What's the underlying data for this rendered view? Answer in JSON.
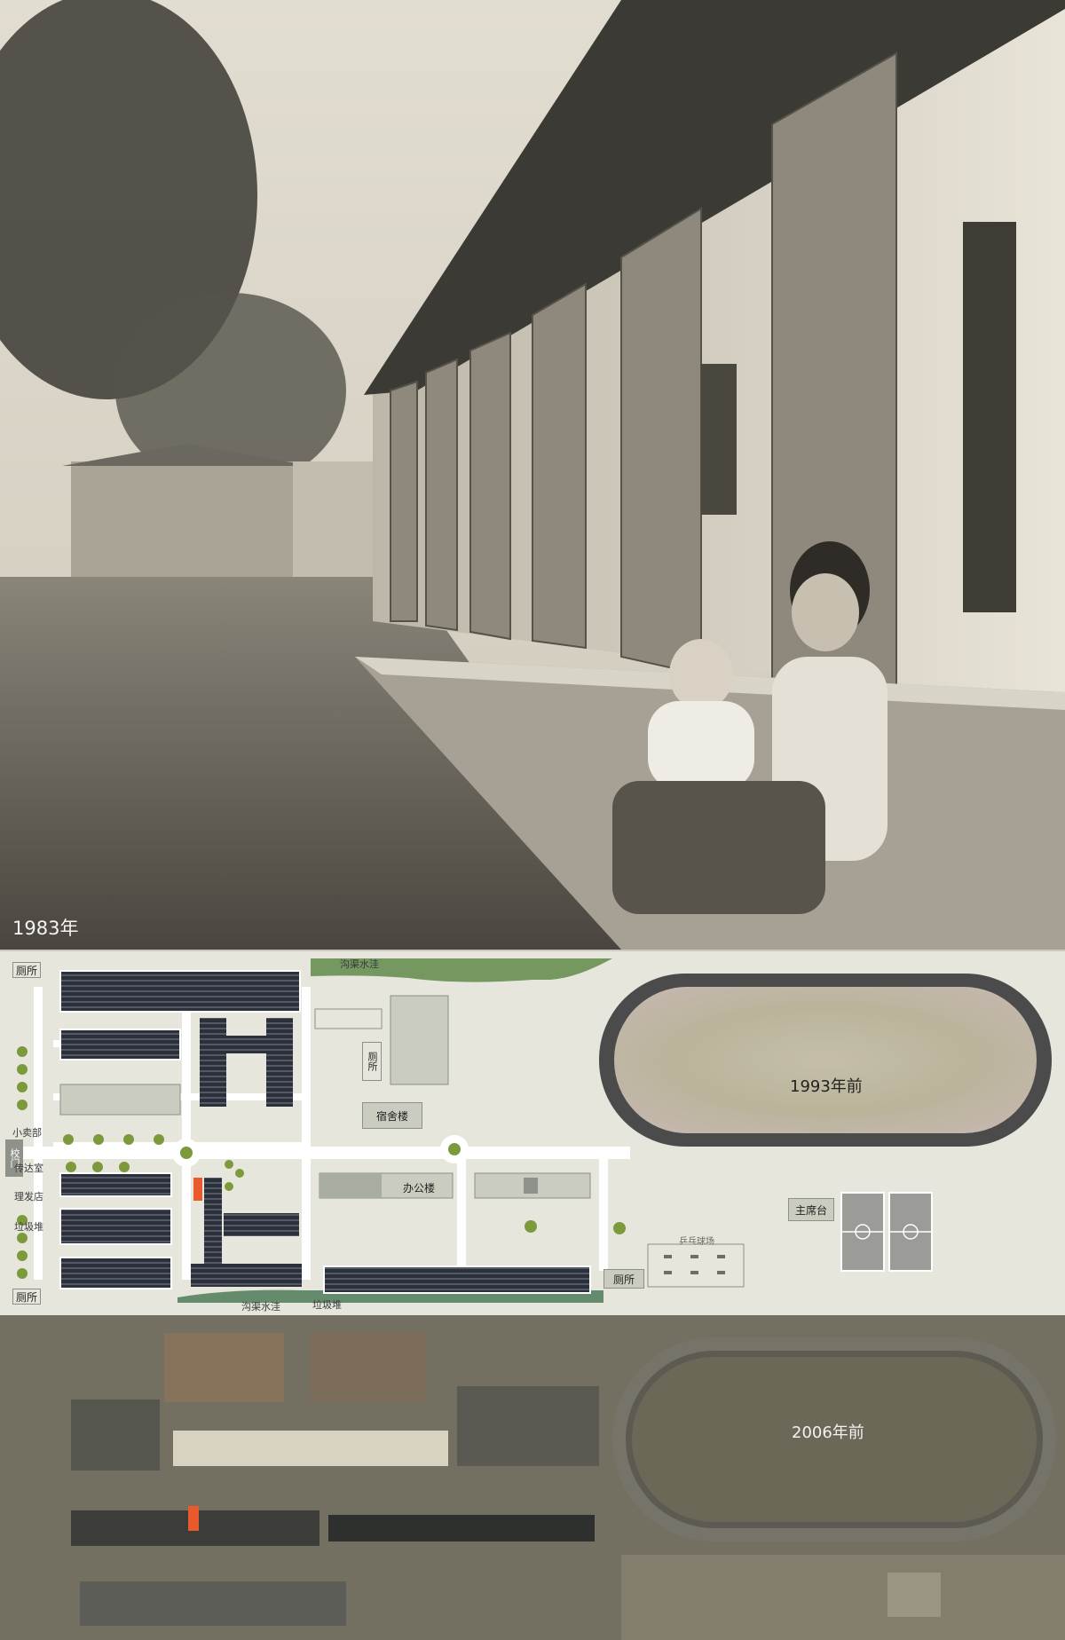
{
  "photo": {
    "year_label": "1983年"
  },
  "plan": {
    "labels": {
      "ditch_top": "沟渠水洼",
      "toilet_topleft": "厕所",
      "toilet_mid": "厕所",
      "dorm": "宿舍楼",
      "shop": "小卖部",
      "gate": "校门",
      "reception": "传达室",
      "barber": "理发店",
      "garbage_left": "垃圾堆",
      "toilet_bottomleft": "厕所",
      "office": "办公楼",
      "podium": "主席台",
      "pingpong": "乒乓球场",
      "toilet_right": "厕所",
      "ditch_bottom": "沟渠水洼",
      "garbage_bottom": "垃圾堆"
    },
    "year_label": "1993年前"
  },
  "satellite": {
    "year_label": "2006年前"
  },
  "colors": {
    "plan_bg": "#e6e6dc",
    "building_fill": "#c9ccbf",
    "roof_dark": "#2a2f3a",
    "track": "#4b4b4b",
    "road": "#ffffff",
    "highlight": "#e8592b",
    "tree": "#7c9a3c"
  },
  "icons": [
    "tree-icon",
    "roundabout-icon"
  ]
}
